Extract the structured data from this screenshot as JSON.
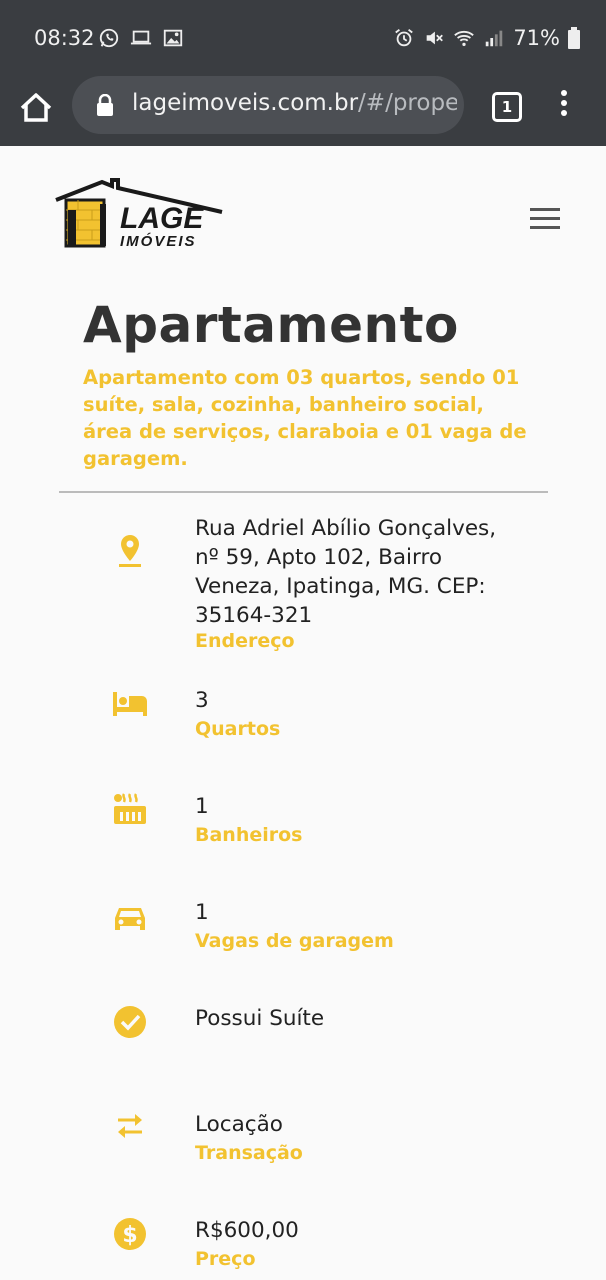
{
  "status_bar": {
    "time": "08:32",
    "battery": "71%"
  },
  "browser": {
    "url_domain": "lageimoveis.com.br",
    "url_path": "/#/propert",
    "tab_count": "1"
  },
  "header": {
    "logo_word_top": "LAGE",
    "logo_word_bottom": "IMÓVEIS"
  },
  "property": {
    "title": "Apartamento",
    "description": "Apartamento com 03 quartos, sendo 01 suíte, sala, cozinha, banheiro social, área de serviços, claraboia e 01 vaga de garagem."
  },
  "details": [
    {
      "icon": "location-pin-icon",
      "value": "Rua Adriel Abílio Gonçalves, nº 59, Apto 102, Bairro Veneza, Ipatinga, MG. CEP: 35164-321",
      "label": "Endereço"
    },
    {
      "icon": "bed-icon",
      "value": "3",
      "label": "Quartos"
    },
    {
      "icon": "hot-tub-icon",
      "value": "1",
      "label": "Banheiros"
    },
    {
      "icon": "car-icon",
      "value": "1",
      "label": "Vagas de garagem"
    },
    {
      "icon": "check-circle-icon",
      "value": "Possui Suíte",
      "label": ""
    },
    {
      "icon": "swap-arrows-icon",
      "value": "Locação",
      "label": "Transação"
    },
    {
      "icon": "dollar-circle-icon",
      "value": "R$600,00",
      "label": "Preço"
    }
  ],
  "colors": {
    "accent": "#f2c230",
    "status_bar": "#3a3d41",
    "url_bar": "#4c4f54",
    "title_text": "#333333"
  }
}
